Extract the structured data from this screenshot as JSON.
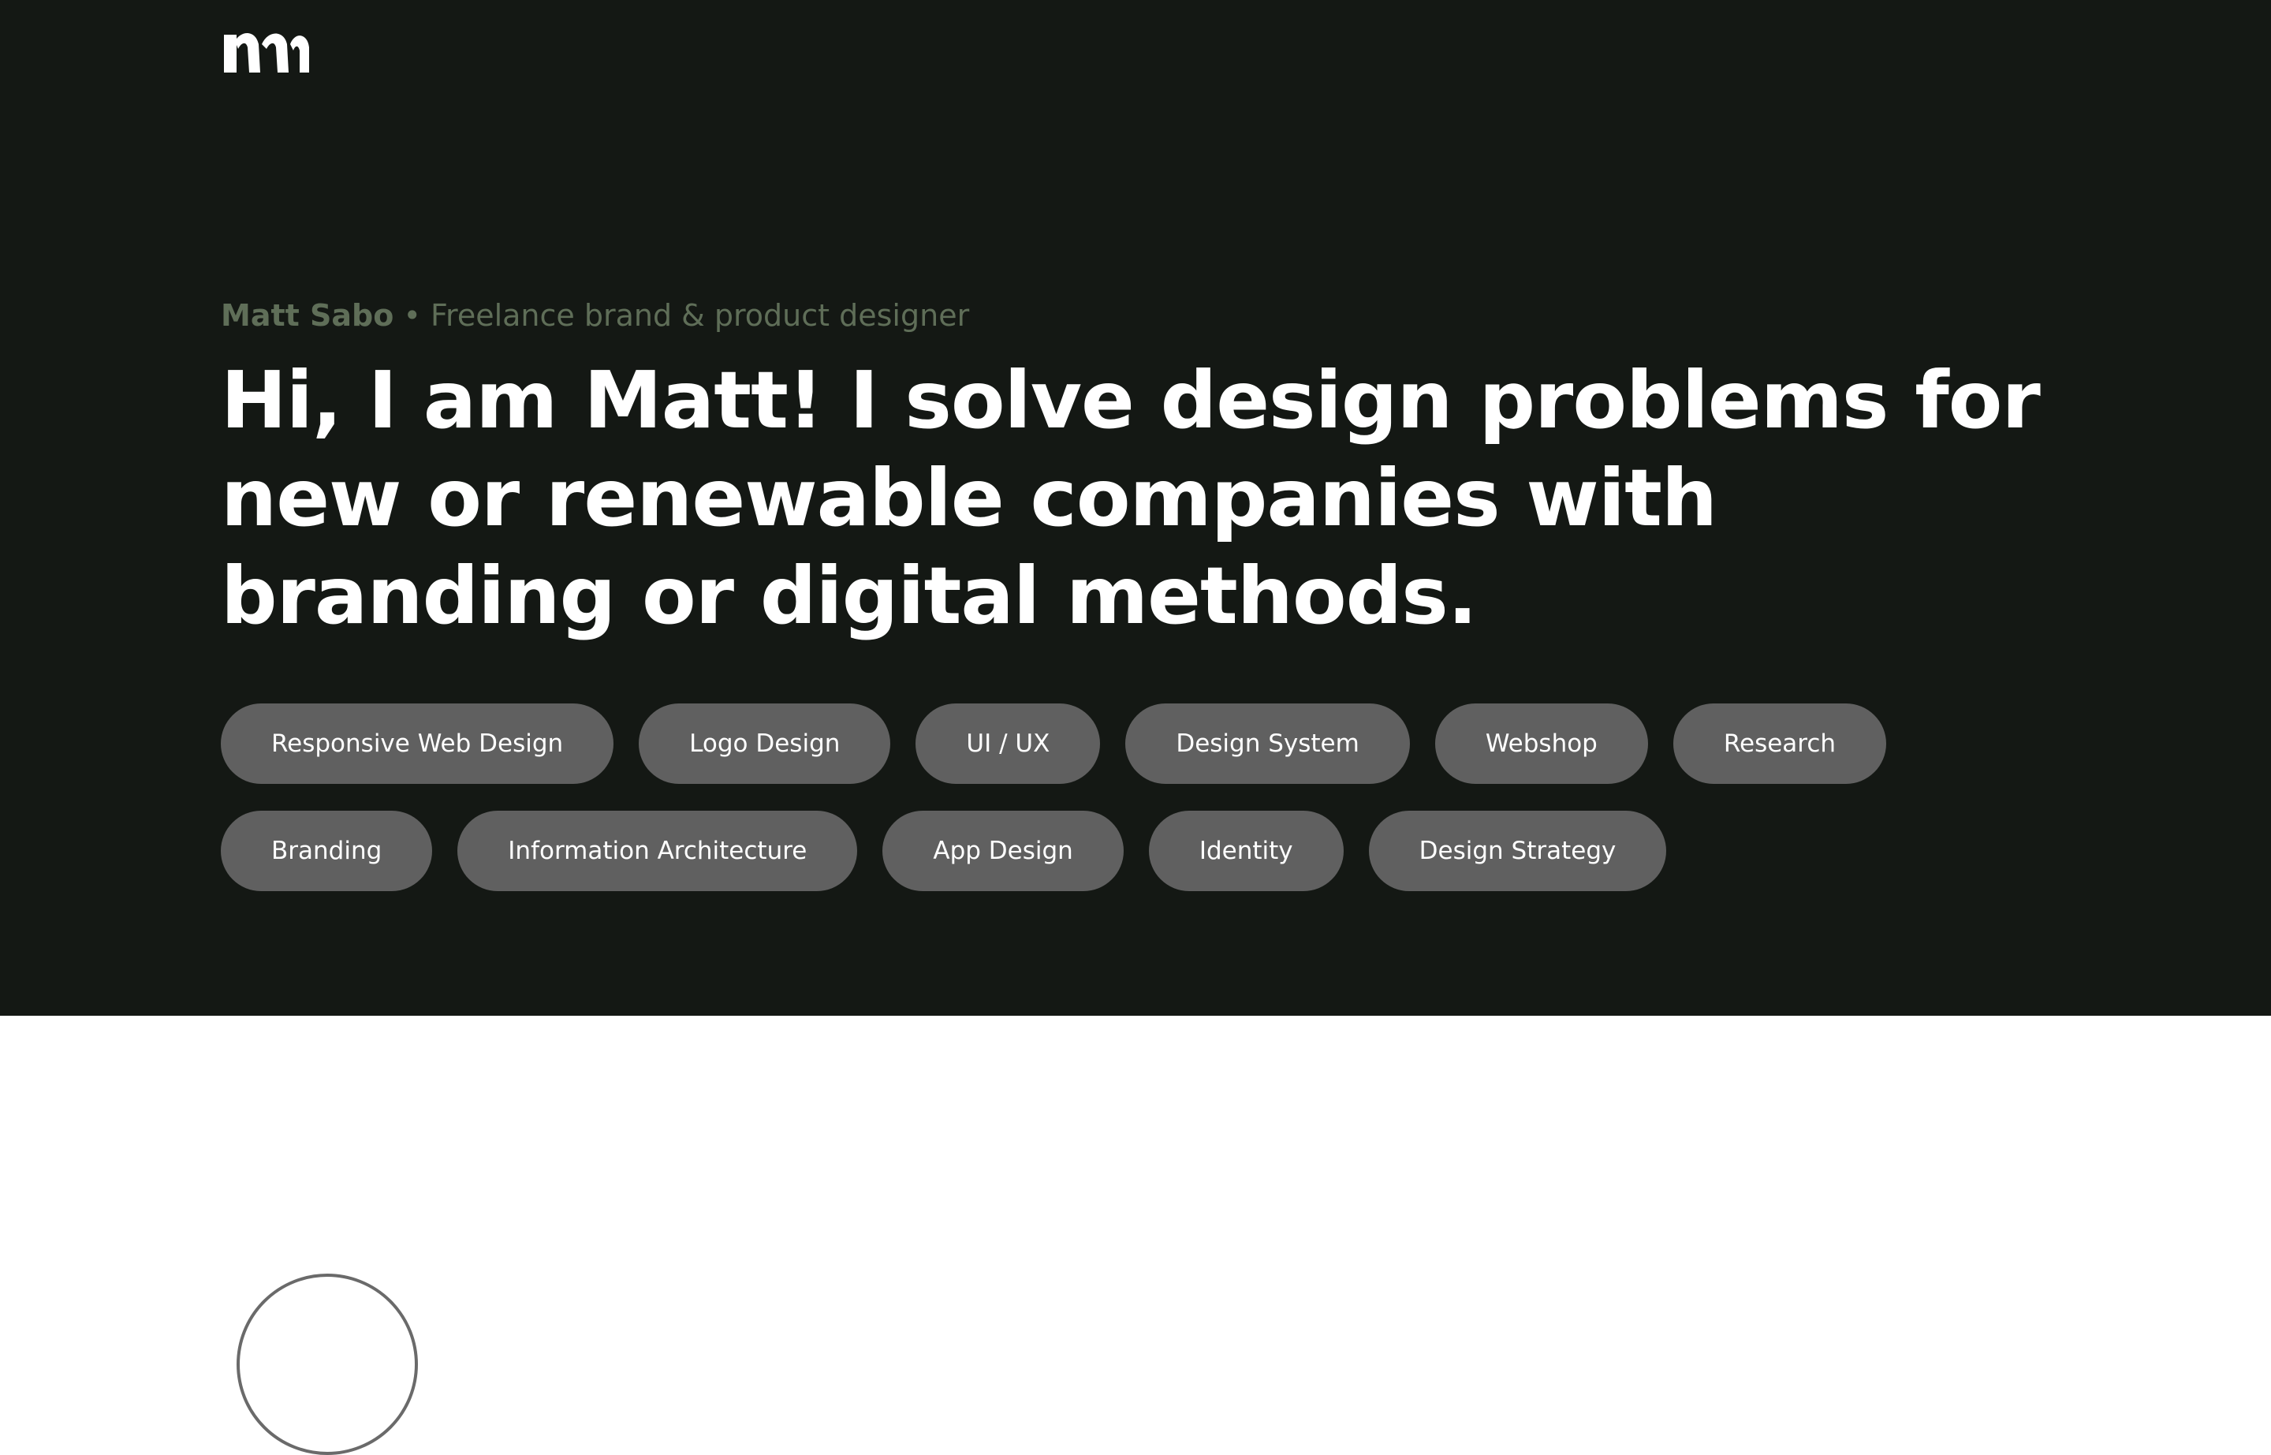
{
  "brand": {
    "logo_icon": "m-wave-logo-icon",
    "accent_color": "#5f6e58"
  },
  "intro": {
    "name": "Matt Sabo",
    "separator": "•",
    "role": "Freelance brand & product designer"
  },
  "headline": "Hi, I am Matt! I solve design problems for new or renewable companies with branding or digital methods.",
  "tags": {
    "row1": [
      "Responsive Web Design",
      "Logo Design",
      "UI / UX",
      "Design System",
      "Webshop",
      "Research"
    ],
    "row2": [
      "Branding",
      "Information Architecture",
      "App Design",
      "Identity",
      "Design Strategy"
    ]
  },
  "colors": {
    "hero_background": "#141814",
    "tag_background": "#606060",
    "text": "#ffffff"
  }
}
